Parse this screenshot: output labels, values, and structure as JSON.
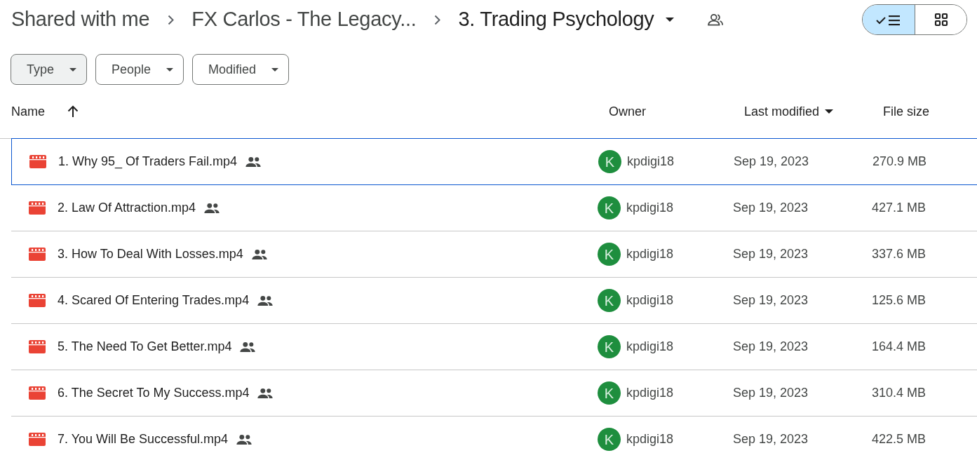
{
  "breadcrumb": [
    {
      "label": "Shared with me",
      "current": false
    },
    {
      "label": "FX Carlos - The Legacy...",
      "current": false
    },
    {
      "label": "3. Trading Psychology",
      "current": true
    }
  ],
  "view_toggle": [
    {
      "kind": "list",
      "selected": true
    },
    {
      "kind": "grid",
      "selected": false
    }
  ],
  "filters": [
    {
      "label": "Type",
      "highlighted": true
    },
    {
      "label": "People",
      "highlighted": false
    },
    {
      "label": "Modified",
      "highlighted": false
    }
  ],
  "table": {
    "columns": [
      {
        "label": "Name",
        "kind": "ascending"
      },
      {
        "label": "Owner",
        "kind": "plain"
      },
      {
        "label": "Last modified",
        "kind": "descending"
      },
      {
        "label": "File size",
        "kind": "plain"
      }
    ],
    "rows": [
      {
        "name": "1. Why 95_ Of Traders Fail.mp4",
        "shared": true,
        "avatar": "K",
        "owner": "kpdigi18",
        "modified": "Sep 19, 2023",
        "size": "270.9 MB",
        "selected": true
      },
      {
        "name": "2. Law Of Attraction.mp4",
        "shared": true,
        "avatar": "K",
        "owner": "kpdigi18",
        "modified": "Sep 19, 2023",
        "size": "427.1 MB",
        "selected": false
      },
      {
        "name": "3. How To Deal With Losses.mp4",
        "shared": true,
        "avatar": "K",
        "owner": "kpdigi18",
        "modified": "Sep 19, 2023",
        "size": "337.6 MB",
        "selected": false
      },
      {
        "name": "4. Scared Of Entering Trades.mp4",
        "shared": true,
        "avatar": "K",
        "owner": "kpdigi18",
        "modified": "Sep 19, 2023",
        "size": "125.6 MB",
        "selected": false
      },
      {
        "name": "5. The Need To Get Better.mp4",
        "shared": true,
        "avatar": "K",
        "owner": "kpdigi18",
        "modified": "Sep 19, 2023",
        "size": "164.4 MB",
        "selected": false
      },
      {
        "name": "6. The Secret To My Success.mp4",
        "shared": true,
        "avatar": "K",
        "owner": "kpdigi18",
        "modified": "Sep 19, 2023",
        "size": "310.4 MB",
        "selected": false
      },
      {
        "name": "7. You Will Be Successful.mp4",
        "shared": true,
        "avatar": "K",
        "owner": "kpdigi18",
        "modified": "Sep 19, 2023",
        "size": "422.5 MB",
        "selected": false
      }
    ]
  }
}
